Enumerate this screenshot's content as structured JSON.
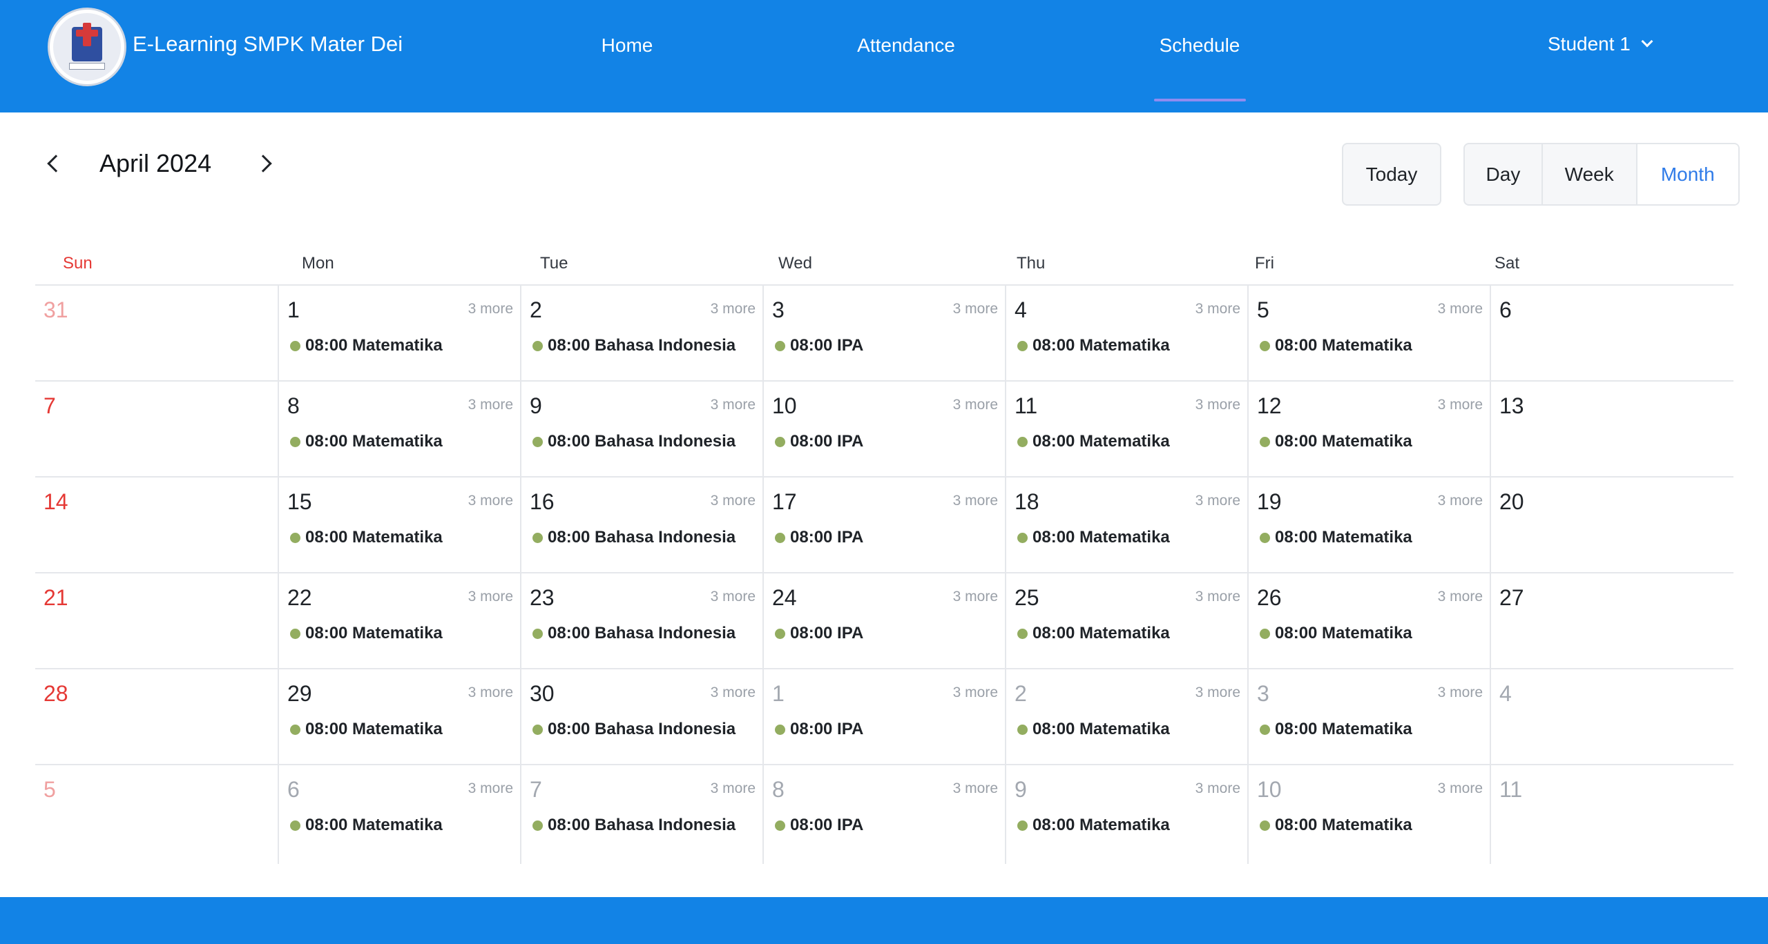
{
  "header": {
    "brand": "E-Learning SMPK Mater Dei",
    "nav": [
      {
        "label": "Home"
      },
      {
        "label": "Attendance"
      },
      {
        "label": "Schedule",
        "active": true
      }
    ],
    "user": "Student 1"
  },
  "calendar": {
    "title": "April 2024",
    "today_label": "Today",
    "views": [
      "Day",
      "Week",
      "Month"
    ],
    "active_view": "Month",
    "weekdays": [
      "Sun",
      "Mon",
      "Tue",
      "Wed",
      "Thu",
      "Fri",
      "Sat"
    ],
    "more_label": "3 more",
    "weeks": [
      [
        {
          "day": "31",
          "other": true
        },
        {
          "day": "1",
          "event": "08:00 Matematika"
        },
        {
          "day": "2",
          "event": "08:00 Bahasa Indonesia"
        },
        {
          "day": "3",
          "event": "08:00 IPA"
        },
        {
          "day": "4",
          "event": "08:00 Matematika"
        },
        {
          "day": "5",
          "event": "08:00 Matematika"
        },
        {
          "day": "6"
        }
      ],
      [
        {
          "day": "7"
        },
        {
          "day": "8",
          "event": "08:00 Matematika"
        },
        {
          "day": "9",
          "event": "08:00 Bahasa Indonesia"
        },
        {
          "day": "10",
          "event": "08:00 IPA"
        },
        {
          "day": "11",
          "event": "08:00 Matematika"
        },
        {
          "day": "12",
          "event": "08:00 Matematika"
        },
        {
          "day": "13"
        }
      ],
      [
        {
          "day": "14"
        },
        {
          "day": "15",
          "event": "08:00 Matematika"
        },
        {
          "day": "16",
          "event": "08:00 Bahasa Indonesia"
        },
        {
          "day": "17",
          "event": "08:00 IPA"
        },
        {
          "day": "18",
          "event": "08:00 Matematika"
        },
        {
          "day": "19",
          "event": "08:00 Matematika"
        },
        {
          "day": "20"
        }
      ],
      [
        {
          "day": "21"
        },
        {
          "day": "22",
          "event": "08:00 Matematika"
        },
        {
          "day": "23",
          "event": "08:00 Bahasa Indonesia"
        },
        {
          "day": "24",
          "event": "08:00 IPA"
        },
        {
          "day": "25",
          "event": "08:00 Matematika"
        },
        {
          "day": "26",
          "event": "08:00 Matematika"
        },
        {
          "day": "27"
        }
      ],
      [
        {
          "day": "28"
        },
        {
          "day": "29",
          "event": "08:00 Matematika"
        },
        {
          "day": "30",
          "event": "08:00 Bahasa Indonesia"
        },
        {
          "day": "1",
          "other": true,
          "event": "08:00 IPA"
        },
        {
          "day": "2",
          "other": true,
          "event": "08:00 Matematika"
        },
        {
          "day": "3",
          "other": true,
          "event": "08:00 Matematika"
        },
        {
          "day": "4",
          "other": true
        }
      ],
      [
        {
          "day": "5",
          "other": true
        },
        {
          "day": "6",
          "other": true,
          "event": "08:00 Matematika"
        },
        {
          "day": "7",
          "other": true,
          "event": "08:00 Bahasa Indonesia"
        },
        {
          "day": "8",
          "other": true,
          "event": "08:00 IPA"
        },
        {
          "day": "9",
          "other": true,
          "event": "08:00 Matematika"
        },
        {
          "day": "10",
          "other": true,
          "event": "08:00 Matematika"
        },
        {
          "day": "11",
          "other": true
        }
      ]
    ]
  },
  "colors": {
    "primary": "#1283e6",
    "active_view": "#2f7be8",
    "sunday": "#e53935",
    "event_dot": "#93ad60",
    "nav_underline": "#8f8cf0"
  }
}
